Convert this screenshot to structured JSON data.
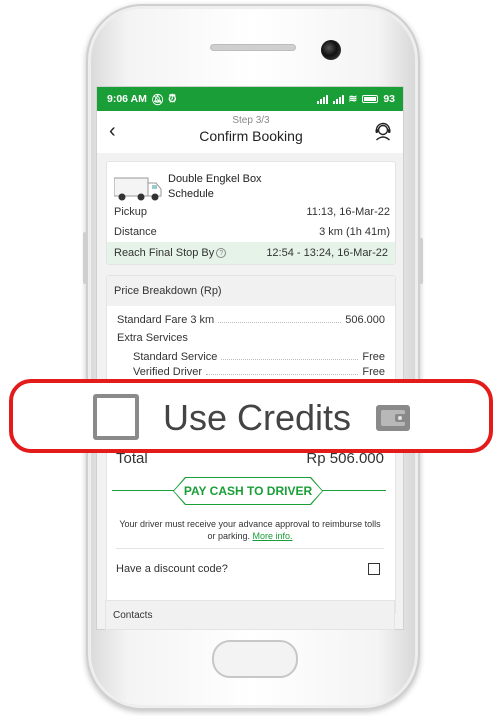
{
  "status_bar": {
    "time": "9:06 AM",
    "battery": "93"
  },
  "header": {
    "step": "Step 3/3",
    "title": "Confirm Booking",
    "back": "‹"
  },
  "booking": {
    "vehicle_name": "Double Engkel Box",
    "vehicle_sub": "Schedule",
    "pickup_label": "Pickup",
    "pickup_value": "11:13, 16-Mar-22",
    "distance_label": "Distance",
    "distance_value": "3 km (1h 41m)",
    "final_label": "Reach Final Stop By",
    "final_value": "12:54 - 13:24, 16-Mar-22"
  },
  "price": {
    "heading": "Price Breakdown (Rp)",
    "standard_fare_label": "Standard Fare 3 km",
    "standard_fare_value": "506.000",
    "extra_services_label": "Extra Services",
    "items": [
      {
        "label": "Standard Service",
        "value": "Free"
      },
      {
        "label": "Verified Driver",
        "value": "Free"
      }
    ],
    "total_label": "Total",
    "total_value": "Rp 506.000"
  },
  "pay_cash_label": "PAY CASH TO DRIVER",
  "note_text": "Your driver must receive your advance approval to reimburse tolls or parking. ",
  "note_link": "More info.",
  "discount_label": "Have a discount code?",
  "contacts_label": "Contacts",
  "callout": {
    "label": "Use Credits"
  },
  "colors": {
    "brand_green": "#1a9e38",
    "callout_red": "#e31b1b"
  },
  "icons": [
    "back-arrow-icon",
    "support-agent-icon",
    "truck-icon",
    "help-circle-icon",
    "checkbox-icon",
    "wallet-icon"
  ]
}
